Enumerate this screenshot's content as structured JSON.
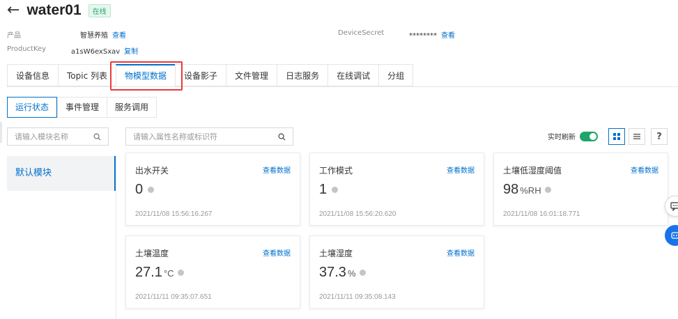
{
  "header": {
    "title": "water01",
    "status": "在线"
  },
  "meta": {
    "product_label": "产品",
    "product_value": "智慧养殖",
    "product_link": "查看",
    "productkey_label": "ProductKey",
    "productkey_value": "a1sW6exSxav",
    "productkey_link": "复制",
    "secret_label": "DeviceSecret",
    "secret_value": "********",
    "secret_link": "查看"
  },
  "tabs": [
    "设备信息",
    "Topic 列表",
    "物模型数据",
    "设备影子",
    "文件管理",
    "日志服务",
    "在线调试",
    "分组"
  ],
  "active_tab": "物模型数据",
  "subtabs": [
    "运行状态",
    "事件管理",
    "服务调用"
  ],
  "module_search": {
    "placeholder": "请输入模块名称"
  },
  "property_search": {
    "placeholder": "请输入属性名称或标识符"
  },
  "modules": [
    "默认模块"
  ],
  "realtime_refresh": {
    "label": "实时刷新",
    "enabled": true
  },
  "help_label": "?",
  "cards": [
    {
      "name": "出水开关",
      "link": "查看数据",
      "value": "0",
      "unit": "",
      "time": "2021/11/08 15:56:16.267"
    },
    {
      "name": "工作模式",
      "link": "查看数据",
      "value": "1",
      "unit": "",
      "time": "2021/11/08 15:56:20.620"
    },
    {
      "name": "土壤低湿度阈值",
      "link": "查看数据",
      "value": "98",
      "unit": "%RH",
      "time": "2021/11/08 16:01:18.771"
    },
    {
      "name": "土壤温度",
      "link": "查看数据",
      "value": "27.1",
      "unit": "°C",
      "time": "2021/11/11 09:35:07.651"
    },
    {
      "name": "土壤湿度",
      "link": "查看数据",
      "value": "37.3",
      "unit": "%",
      "time": "2021/11/11 09:35:08.143"
    }
  ],
  "colors": {
    "accent": "#0070cc",
    "online": "#1fa56a",
    "highlight": "#e83a3a"
  }
}
